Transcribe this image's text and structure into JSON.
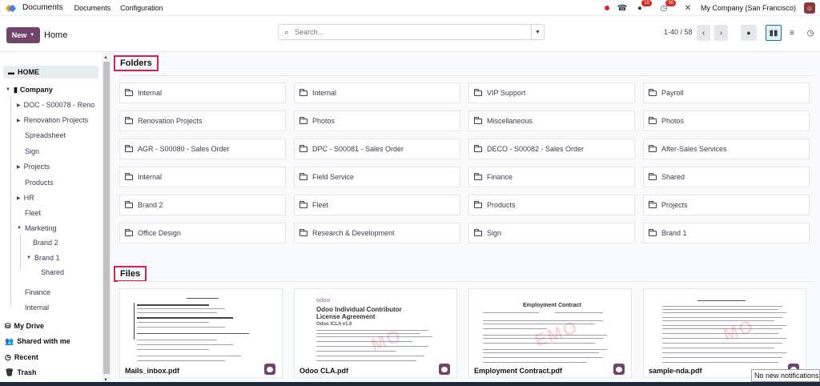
{
  "topbar": {
    "app_title": "Documents",
    "menus": [
      "Documents",
      "Configuration"
    ],
    "chat_badge": "10",
    "activity_badge": "36",
    "company": "My Company (San Francisco)",
    "avatar_icon": "avatar-icon"
  },
  "controls": {
    "new_label": "New",
    "breadcrumb": "Home",
    "search_placeholder": "Search...",
    "pager": "1-40 / 58"
  },
  "sidebar": {
    "home": "HOME",
    "company": "Company",
    "items": [
      "DOC - S00078 - Reno",
      "Renovation Projects",
      "Spreadsheet",
      "Sign",
      "Projects",
      "Products",
      "HR",
      "Fleet",
      "Marketing",
      "Brand 2",
      "Brand 1",
      "Shared",
      "Finance",
      "Internal"
    ],
    "my_drive": "My Drive",
    "shared_with_me": "Shared with me",
    "recent": "Recent",
    "trash": "Trash"
  },
  "folders_title": "Folders",
  "folders": [
    "Internal",
    "Internal",
    "VIP Support",
    "Payroll",
    "Renovation Projects",
    "Photos",
    "Miscellaneous",
    "Photos",
    "AGR - S00080 - Sales Order",
    "DPC - S00081 - Sales Order",
    "DECO - S00082 - Sales Order",
    "After-Sales Services",
    "Internal",
    "Field Service",
    "Finance",
    "Shared",
    "Brand 2",
    "Fleet",
    "Products",
    "Projects",
    "Office Design",
    "Research & Development",
    "Sign",
    "Brand 1"
  ],
  "files_title": "Files",
  "files": [
    {
      "name": "Mails_inbox.pdf"
    },
    {
      "name": "Odoo CLA.pdf",
      "heading": "Odoo Individual Contributor License Agreement",
      "sub": "Odoo ICLA v1.0"
    },
    {
      "name": "Employment Contract.pdf",
      "heading": "Employment Contract"
    },
    {
      "name": "sample-nda.pdf"
    }
  ],
  "toast": "No new notifications",
  "colors": {
    "brand": "#71456b",
    "accent": "#017e84",
    "highlight": "#e11d48"
  }
}
